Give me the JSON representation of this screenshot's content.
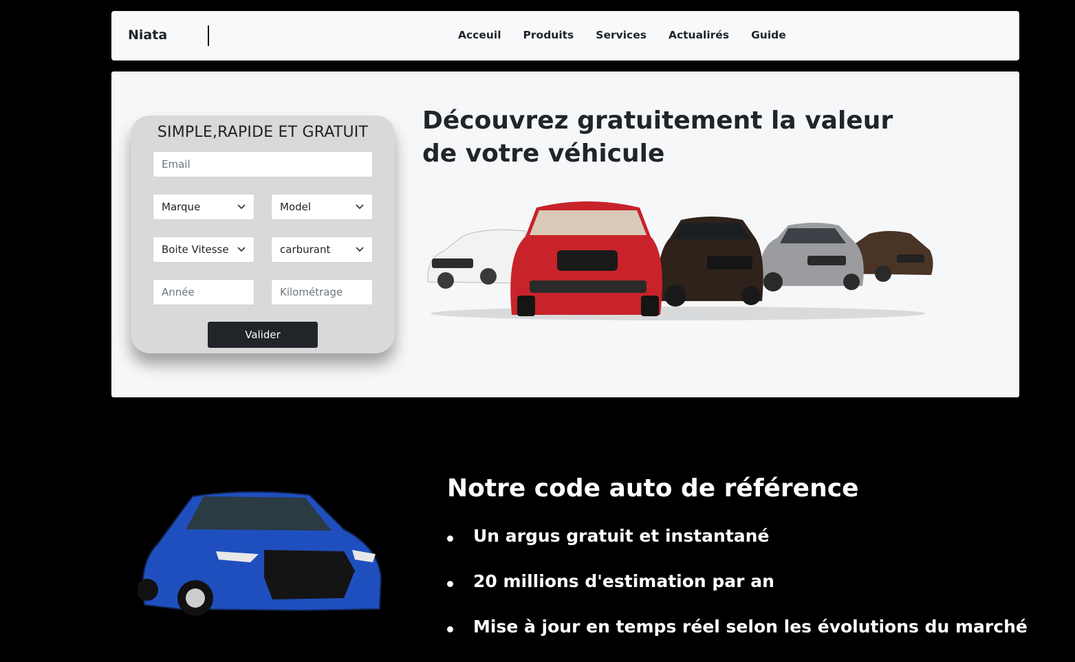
{
  "brand": "Niata",
  "nav": {
    "items": [
      {
        "label": "Acceuil"
      },
      {
        "label": "Produits"
      },
      {
        "label": "Services"
      },
      {
        "label": "Actualirés"
      },
      {
        "label": "Guide"
      }
    ]
  },
  "form": {
    "title": "SIMPLE,RAPIDE ET GRATUIT",
    "email_placeholder": "Email",
    "marque": "Marque",
    "model": "Model",
    "boite": "Boite Vitesse",
    "carburant": "carburant",
    "annee_placeholder": "Année",
    "km_placeholder": "Kilométrage",
    "submit": "Valider"
  },
  "hero": {
    "title": "Découvrez gratuitement la valeur de votre véhicule"
  },
  "section": {
    "title": "Notre code auto de référence",
    "features": [
      "Un argus gratuit et instantané",
      "20 millions d'estimation par an",
      "Mise à jour en temps réel selon les évolutions du marché"
    ]
  }
}
